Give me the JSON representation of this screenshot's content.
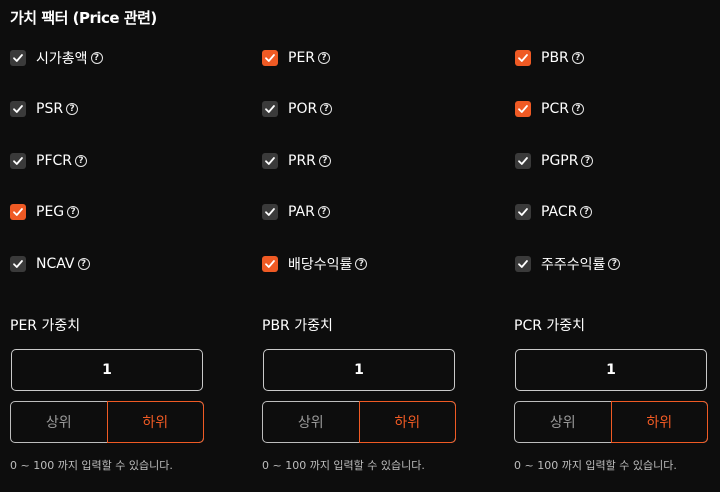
{
  "section_title": "가치 팩터 (Price 관련)",
  "help_glyph": "?",
  "factors": [
    {
      "label": "시가총액",
      "checked": false
    },
    {
      "label": "PER",
      "checked": true
    },
    {
      "label": "PBR",
      "checked": true
    },
    {
      "label": "PSR",
      "checked": false
    },
    {
      "label": "POR",
      "checked": false
    },
    {
      "label": "PCR",
      "checked": true
    },
    {
      "label": "PFCR",
      "checked": false
    },
    {
      "label": "PRR",
      "checked": false
    },
    {
      "label": "PGPR",
      "checked": false
    },
    {
      "label": "PEG",
      "checked": true
    },
    {
      "label": "PAR",
      "checked": false
    },
    {
      "label": "PACR",
      "checked": false
    },
    {
      "label": "NCAV",
      "checked": false
    },
    {
      "label": "배당수익률",
      "checked": true
    },
    {
      "label": "주주수익률",
      "checked": false
    }
  ],
  "weights": [
    {
      "label": "PER 가중치",
      "value": "1",
      "upper": "상위",
      "lower": "하위",
      "selected": "하위",
      "hint": "0 ~ 100 까지 입력할 수 있습니다."
    },
    {
      "label": "PBR 가중치",
      "value": "1",
      "upper": "상위",
      "lower": "하위",
      "selected": "하위",
      "hint": "0 ~ 100 까지 입력할 수 있습니다."
    },
    {
      "label": "PCR 가중치",
      "value": "1",
      "upper": "상위",
      "lower": "하위",
      "selected": "하위",
      "hint": "0 ~ 100 까지 입력할 수 있습니다."
    }
  ],
  "colors": {
    "accent": "#ef5a24",
    "unchecked": "#3a3a3a",
    "background": "#0d0d0d"
  }
}
